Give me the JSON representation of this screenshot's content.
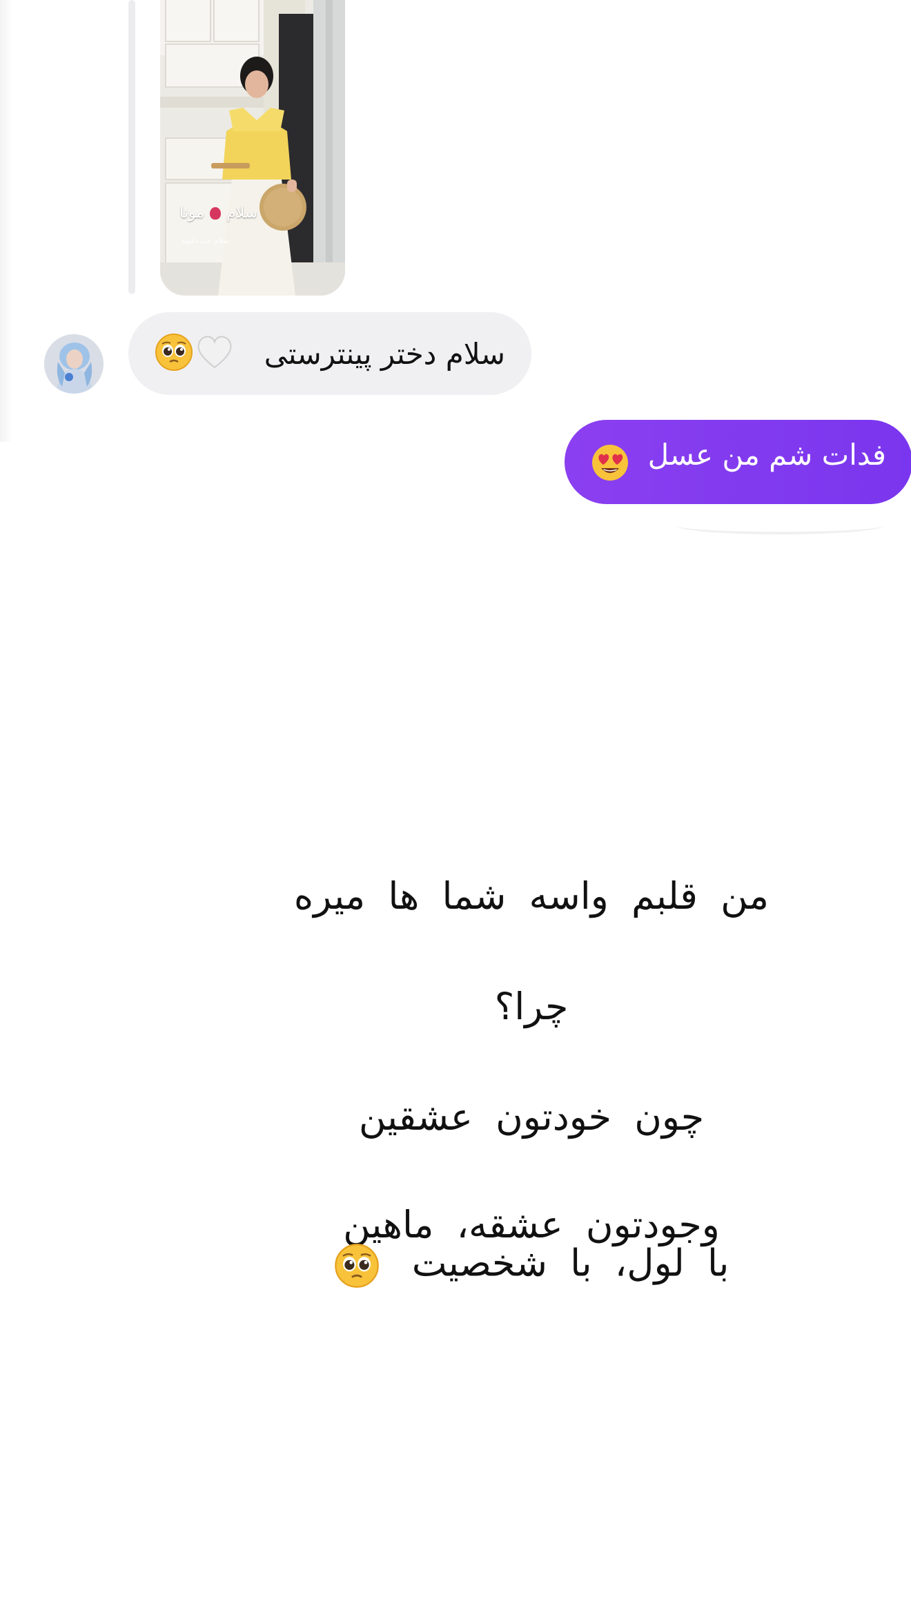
{
  "story": {
    "caption_left": "مونا",
    "caption_right": "سلام",
    "subcaption": "سلام چند دقیقه"
  },
  "conversation": {
    "received_message": "سلام دختر پینترستی",
    "received_emojis": [
      "pleading-face",
      "white-heart"
    ],
    "sent_message": "فدات شم من عسل",
    "sent_emoji": "heart-eyes-face"
  },
  "poem": {
    "line1": "من قلبم واسه شما ها میره",
    "line2": "چرا؟",
    "line3": "چون خودتون عشقین",
    "line4": "وجودتون عشقه، ماهین",
    "line5": "با لول، با شخصیت",
    "line5_emoji": "pleading-face"
  },
  "colors": {
    "sent_bubble": "#7c3aed",
    "received_bubble": "#f0f0f2"
  }
}
